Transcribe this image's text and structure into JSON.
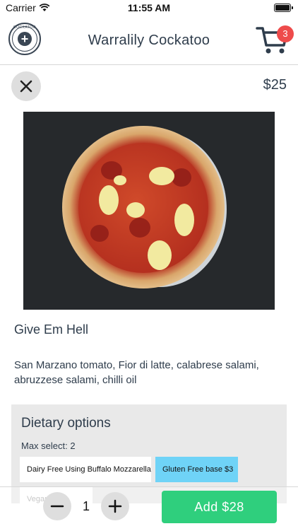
{
  "status_bar": {
    "carrier": "Carrier",
    "time": "11:55 AM"
  },
  "header": {
    "logo_text": "COCKATOO",
    "brand": "Warralily Cockatoo",
    "cart_count": "3"
  },
  "item": {
    "price": "$25",
    "title": "Give Em Hell",
    "description": "San Marzano tomato, Fior di latte, calabrese salami, abruzzese salami, chilli oil"
  },
  "dietary": {
    "title": "Dietary options",
    "max_select": "Max select: 2",
    "options": [
      {
        "label": "Dairy Free Using Buffalo Mozzarella",
        "selected": false
      },
      {
        "label": "Gluten Free base $3",
        "selected": true
      },
      {
        "label": "Vegan"
      }
    ]
  },
  "order": {
    "quantity": "1",
    "add_label": "Add $28"
  },
  "colors": {
    "accent_green": "#2fcf7d",
    "selected_option": "#6fd3f7",
    "badge_red": "#ee4b4b",
    "text_dark": "#2f3d4c"
  },
  "icons": [
    "wifi-icon",
    "battery-icon",
    "logo-icon",
    "cart-icon",
    "close-icon",
    "minus-icon",
    "plus-icon"
  ]
}
